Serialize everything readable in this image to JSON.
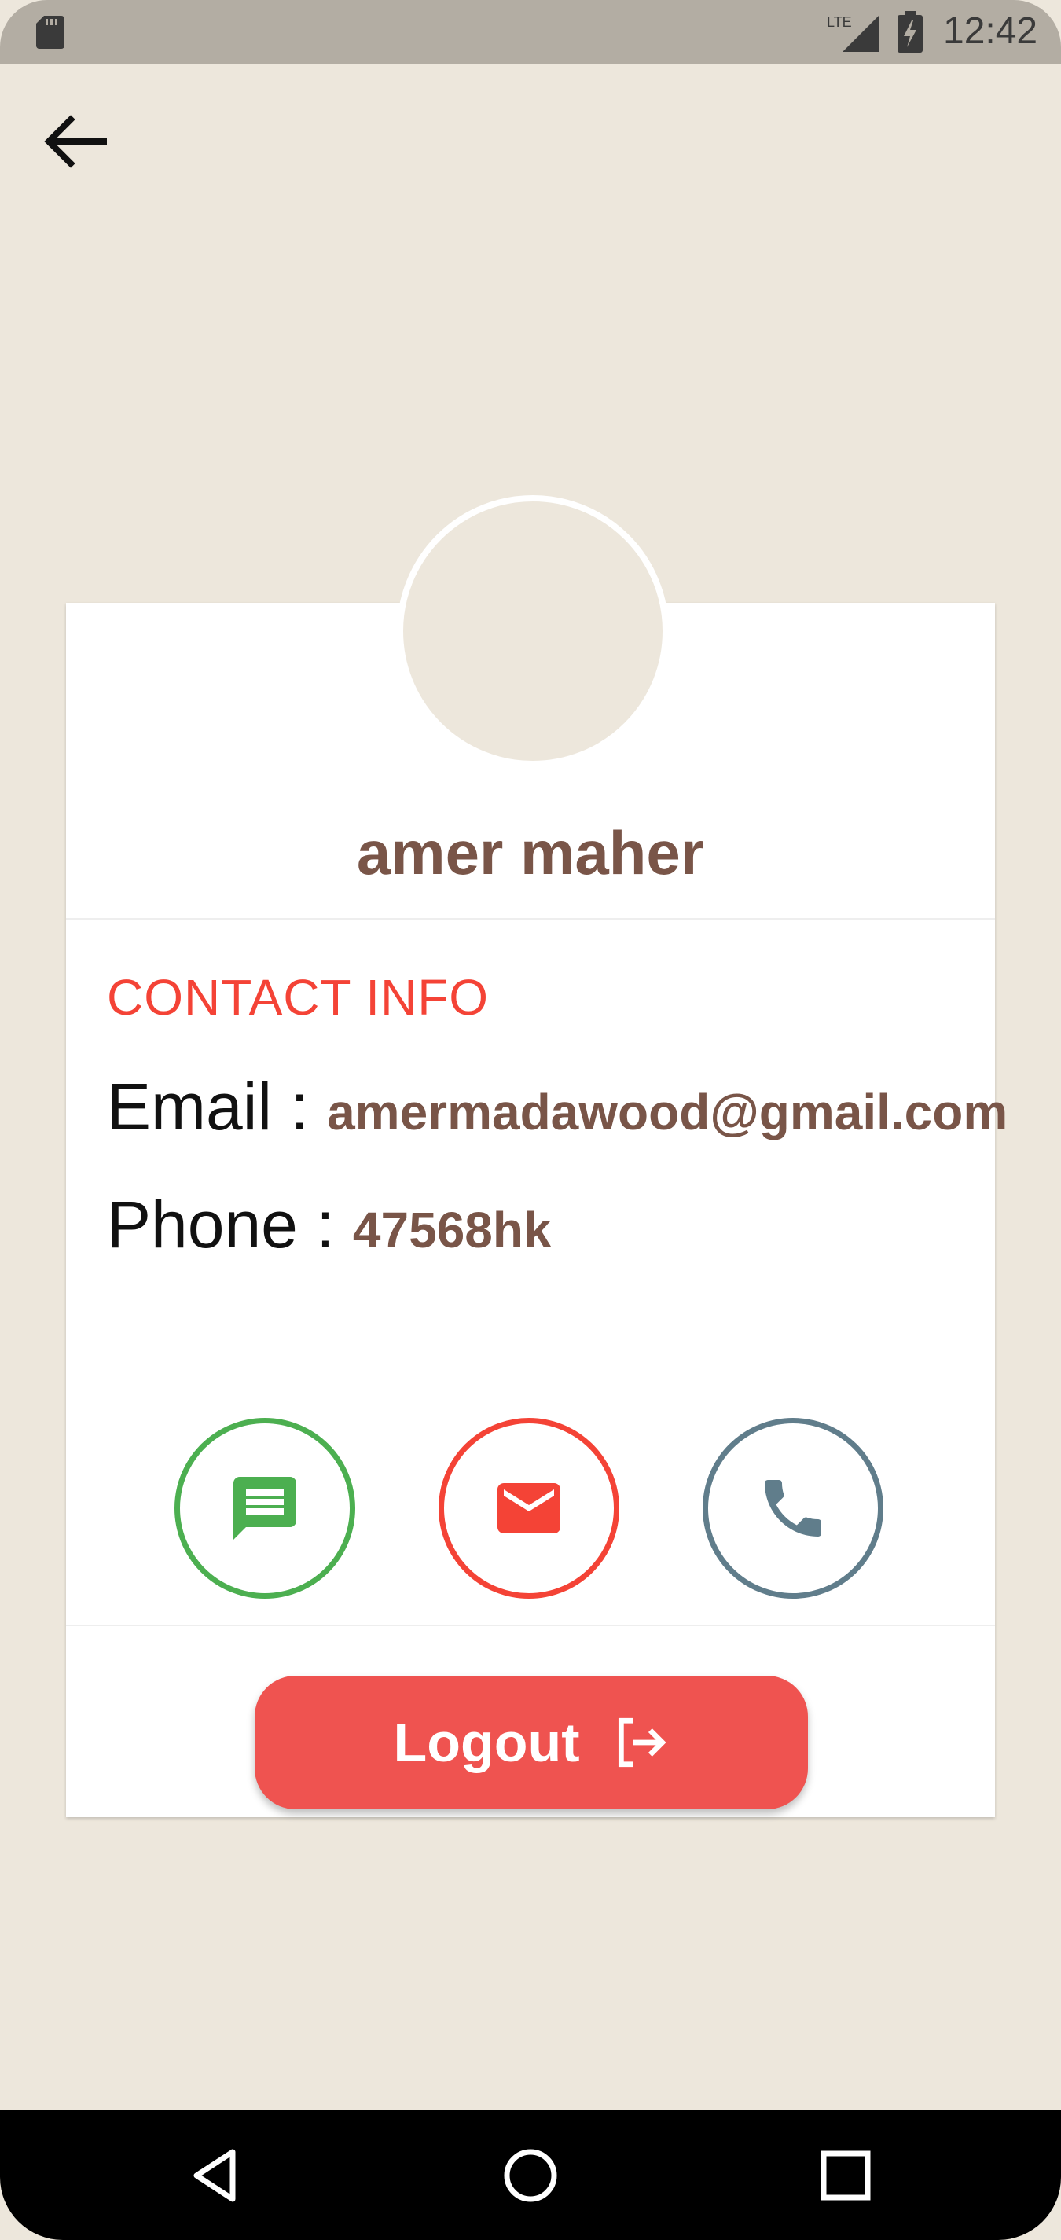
{
  "status_bar": {
    "network_label": "LTE",
    "time": "12:42"
  },
  "profile": {
    "name": "amer maher"
  },
  "contact": {
    "section_title": "CONTACT INFO",
    "email_label": "Email : ",
    "email_value": "amermadawood@gmail.com",
    "phone_label": "Phone : ",
    "phone_value": "47568hk"
  },
  "actions": {
    "message_color": "#4caf50",
    "email_color": "#f44336",
    "phone_color": "#607d8b"
  },
  "logout": {
    "label": "Logout",
    "color": "#ef5350"
  },
  "theme": {
    "background": "#ede7dc",
    "accent_brown": "#795548",
    "accent_red": "#f44336"
  },
  "icons": [
    "sd-card-icon",
    "lte-signal-icon",
    "battery-charging-icon",
    "back-arrow-icon",
    "message-icon",
    "email-icon",
    "phone-icon",
    "logout-icon",
    "nav-back-icon",
    "nav-home-icon",
    "nav-recents-icon"
  ]
}
